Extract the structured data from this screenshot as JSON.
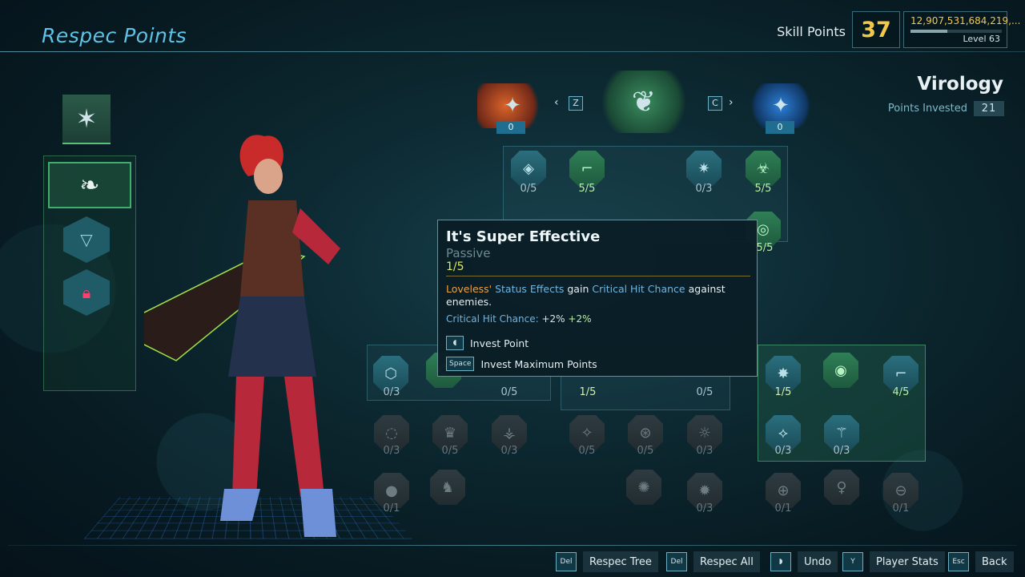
{
  "header": {
    "title": "Respec Points",
    "skill_points_label": "Skill Points",
    "skill_points": "37",
    "xp": "12,907,531,684,219,...",
    "level": "Level 63"
  },
  "tree": {
    "name": "Virology",
    "points_invested_label": "Points Invested",
    "points_invested": "21"
  },
  "class_selector": {
    "left_count": "0",
    "right_count": "0",
    "prev_key": "Z",
    "next_key": "C"
  },
  "nodes": {
    "r1": [
      "0/5",
      "5/5",
      "0/3",
      "5/5"
    ],
    "r2_right": "5/5",
    "left_panel": [
      "0/3",
      "0/5"
    ],
    "mid_panel": [
      "1/5",
      "0/5"
    ],
    "right_panel": [
      "1/5",
      "4/5"
    ],
    "row4": [
      "0/3",
      "0/5",
      "0/3",
      "0/5",
      "0/5",
      "0/3",
      "0/3",
      "0/3"
    ],
    "row5": [
      "0/1",
      "0/3",
      "0/1",
      "0/1"
    ]
  },
  "tooltip": {
    "title": "It's Super Effective",
    "type": "Passive",
    "rank": "1/5",
    "desc_part1": "Loveless'",
    "desc_part2": "Status Effects",
    "desc_part3": "gain",
    "desc_part4": "Critical Hit Chance",
    "desc_part5": "against enemies.",
    "stat_label": "Critical Hit Chance:",
    "stat_value": "+2%",
    "stat_bonus": "+2%",
    "action1": "Invest Point",
    "action2": "Invest Maximum Points",
    "action2_key": "Space"
  },
  "footer": {
    "respec_tree": "Respec Tree",
    "respec_all": "Respec All",
    "undo": "Undo",
    "player_stats": "Player Stats",
    "back": "Back",
    "key_del": "Del",
    "key_y": "Y",
    "key_esc": "Esc"
  },
  "colors": {
    "accent": "#5ec3e6",
    "gold": "#f3c74a",
    "green": "#b9f0a2",
    "lock": "#ff3f6b"
  }
}
